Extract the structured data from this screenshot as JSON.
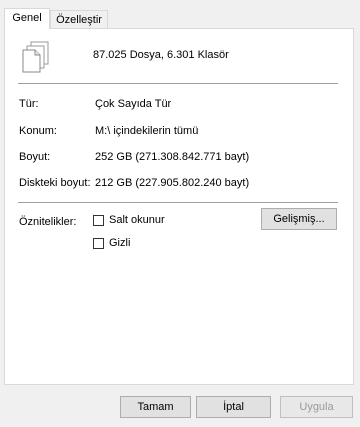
{
  "tabs": [
    {
      "label": "Genel",
      "active": true
    },
    {
      "label": "Özelleştir",
      "active": false
    }
  ],
  "summary": "87.025 Dosya, 6.301 Klasör",
  "properties": {
    "type": {
      "label": "Tür:",
      "value": "Çok Sayıda Tür"
    },
    "location": {
      "label": "Konum:",
      "value": "M:\\ içindekilerin tümü"
    },
    "size": {
      "label": "Boyut:",
      "value": "252 GB (271.308.842.771 bayt)"
    },
    "disk_size": {
      "label": "Diskteki boyut:",
      "value": "212 GB (227.905.802.240 bayt)"
    }
  },
  "attributes": {
    "label": "Öznitelikler:",
    "readonly": {
      "label": "Salt okunur",
      "checked": false
    },
    "hidden": {
      "label": "Gizli",
      "checked": false
    },
    "advanced_button": "Gelişmiş..."
  },
  "footer": {
    "ok": "Tamam",
    "cancel": "İptal",
    "apply": "Uygula"
  },
  "icons": {
    "files": "multiple-files-icon"
  }
}
